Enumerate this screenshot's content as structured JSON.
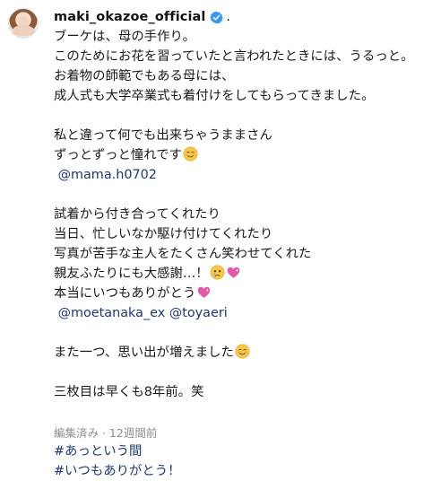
{
  "post": {
    "username": "maki_okazoe_official",
    "separator": ".",
    "lines": [
      "ブーケは、母の手作り。",
      "このためにお花を習っていたと言われたときには、うるっと。",
      "お着物の師範でもある母には、",
      "成人式も大学卒業式も着付けをしてもらってきました。",
      "",
      "私と違って何でも出来ちゃうままさん",
      "ずっとずっと憧れです",
      "@mama.h0702",
      "",
      "試着から付き合ってくれたり",
      "当日、忙しいなか駆け付けてくれたり",
      "写真が苦手な主人をたくさん笑わせてくれた",
      "親友ふたりにも大感謝…！",
      "本当にいつもありがとう",
      "@moetanaka_ex @toyaeri",
      "",
      "また一つ、思い出が増えました",
      "",
      "三枚目は早くも8年前。笑",
      "",
      "",
      "#あっという間",
      "#いつもありがとう！"
    ],
    "meta": "編集済み · 12週間前"
  },
  "icons": {
    "verified": "verified-badge-icon",
    "smile": "smiling-face-emoji",
    "teary": "crying-face-emoji",
    "heart": "sparkling-heart-emoji"
  },
  "colors": {
    "link": "#1f3a6b",
    "verified": "#3897f0",
    "meta": "#8e8e8e",
    "heart": "#e05aa8"
  }
}
